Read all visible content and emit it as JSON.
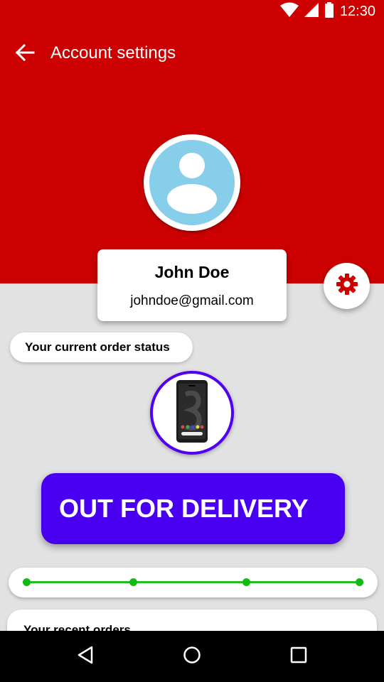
{
  "status_bar": {
    "time": "12:30",
    "icons": [
      "wifi-icon",
      "signal-icon",
      "battery-icon"
    ]
  },
  "toolbar": {
    "back_icon": "arrow-back-icon",
    "title": "Account settings"
  },
  "colors": {
    "header": "#cc0000",
    "background": "#e2e2e2",
    "avatar": "#87ceeb",
    "accent": "#4a00f0",
    "progress": "#11bb11",
    "settings_icon": "#cc0000"
  },
  "profile": {
    "avatar_icon": "person-icon",
    "name": "John Doe",
    "email": "johndoe@gmail.com"
  },
  "settings_button": {
    "icon": "gear-icon"
  },
  "order_status": {
    "chip_label": "Your current order status",
    "product_image": "phone-image",
    "status_label": "OUT FOR DELIVERY",
    "progress_steps": 4,
    "progress_current_step": 4
  },
  "recent_orders": {
    "title": "Your recent orders"
  },
  "nav_bar": {
    "buttons": [
      "back-triangle-icon",
      "home-circle-icon",
      "recents-square-icon"
    ]
  }
}
